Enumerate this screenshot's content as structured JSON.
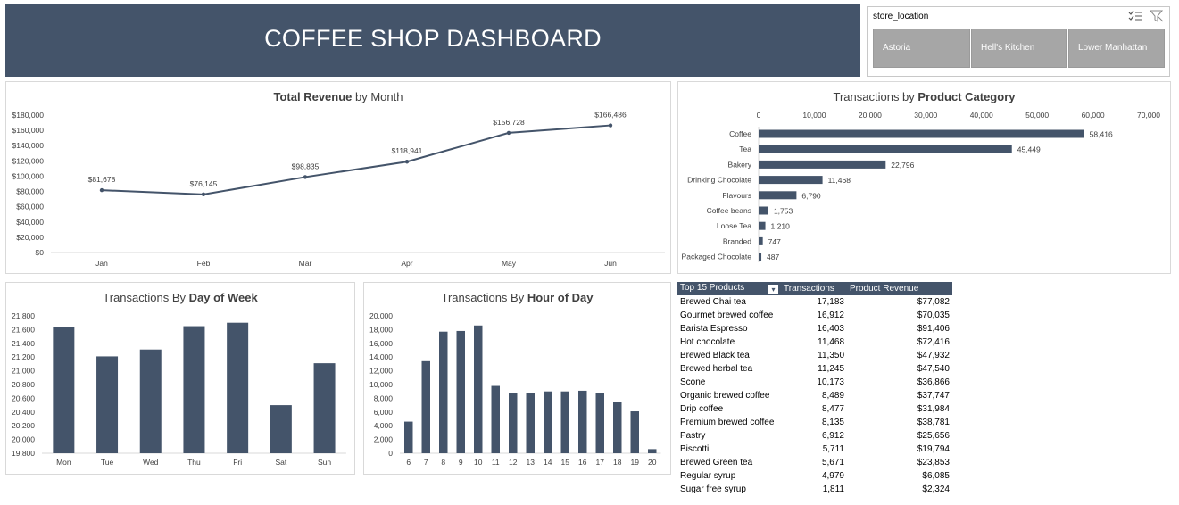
{
  "header": {
    "title": "COFFEE SHOP DASHBOARD"
  },
  "slicer": {
    "title": "store_location",
    "options": [
      "Astoria",
      "Hell's Kitchen",
      "Lower Manhattan"
    ]
  },
  "colors": {
    "banner": "#44546a",
    "series": "#44546a",
    "slicer_button": "#a6a6a6"
  },
  "icons": {
    "multi_select": "multi-select-icon",
    "clear_filter": "clear-filter-icon"
  },
  "chart_data": [
    {
      "id": "revenue",
      "type": "line",
      "title_bold": "Total Revenue",
      "title_rest": " by Month",
      "categories": [
        "Jan",
        "Feb",
        "Mar",
        "Apr",
        "May",
        "Jun"
      ],
      "values": [
        81678,
        76145,
        98835,
        118941,
        156728,
        166486
      ],
      "data_labels": [
        "$81,678",
        "$76,145",
        "$98,835",
        "$118,941",
        "$156,728",
        "$166,486"
      ],
      "y_ticks": [
        "$0",
        "$20,000",
        "$40,000",
        "$60,000",
        "$80,000",
        "$100,000",
        "$120,000",
        "$140,000",
        "$160,000",
        "$180,000"
      ],
      "ylim": [
        0,
        180000
      ],
      "grid": false
    },
    {
      "id": "category",
      "type": "bar",
      "orientation": "horizontal",
      "title_rest": "Transactions by ",
      "title_bold": "Product Category",
      "categories": [
        "Coffee",
        "Tea",
        "Bakery",
        "Drinking Chocolate",
        "Flavours",
        "Coffee beans",
        "Loose Tea",
        "Branded",
        "Packaged Chocolate"
      ],
      "values": [
        58416,
        45449,
        22796,
        11468,
        6790,
        1753,
        1210,
        747,
        487
      ],
      "data_labels": [
        "58,416",
        "45,449",
        "22,796",
        "11,468",
        "6,790",
        "1,753",
        "1,210",
        "747",
        "487"
      ],
      "x_ticks": [
        "0",
        "10,000",
        "20,000",
        "30,000",
        "40,000",
        "50,000",
        "60,000",
        "70,000"
      ],
      "xlim": [
        0,
        70000
      ],
      "axis_position": "top"
    },
    {
      "id": "weekday",
      "type": "bar",
      "title_rest": "Transactions By ",
      "title_bold": "Day of  Week",
      "categories": [
        "Mon",
        "Tue",
        "Wed",
        "Thu",
        "Fri",
        "Sat",
        "Sun"
      ],
      "values": [
        21640,
        21210,
        21310,
        21650,
        21700,
        20500,
        21110
      ],
      "y_ticks": [
        "19,800",
        "20,000",
        "20,200",
        "20,400",
        "20,600",
        "20,800",
        "21,000",
        "21,200",
        "21,400",
        "21,600",
        "21,800"
      ],
      "ylim": [
        19800,
        21800
      ]
    },
    {
      "id": "hour",
      "type": "bar",
      "title_rest": "Transactions By ",
      "title_bold": "Hour of Day",
      "categories": [
        "6",
        "7",
        "8",
        "9",
        "10",
        "11",
        "12",
        "13",
        "14",
        "15",
        "16",
        "17",
        "18",
        "19",
        "20"
      ],
      "values": [
        4600,
        13400,
        17700,
        17800,
        18600,
        9800,
        8700,
        8800,
        9000,
        9000,
        9100,
        8700,
        7500,
        6100,
        600
      ],
      "y_ticks": [
        "0",
        "2,000",
        "4,000",
        "6,000",
        "8,000",
        "10,000",
        "12,000",
        "14,000",
        "16,000",
        "18,000",
        "20,000"
      ],
      "ylim": [
        0,
        20000
      ]
    }
  ],
  "top15": {
    "headers": [
      "Top 15 Products",
      "Transactions",
      "Product Revenue"
    ],
    "rows": [
      [
        "Brewed Chai tea",
        "17,183",
        "$77,082"
      ],
      [
        "Gourmet brewed coffee",
        "16,912",
        "$70,035"
      ],
      [
        "Barista Espresso",
        "16,403",
        "$91,406"
      ],
      [
        "Hot chocolate",
        "11,468",
        "$72,416"
      ],
      [
        "Brewed Black tea",
        "11,350",
        "$47,932"
      ],
      [
        "Brewed herbal tea",
        "11,245",
        "$47,540"
      ],
      [
        "Scone",
        "10,173",
        "$36,866"
      ],
      [
        "Organic brewed coffee",
        "8,489",
        "$37,747"
      ],
      [
        "Drip coffee",
        "8,477",
        "$31,984"
      ],
      [
        "Premium brewed coffee",
        "8,135",
        "$38,781"
      ],
      [
        "Pastry",
        "6,912",
        "$25,656"
      ],
      [
        "Biscotti",
        "5,711",
        "$19,794"
      ],
      [
        "Brewed Green tea",
        "5,671",
        "$23,853"
      ],
      [
        "Regular syrup",
        "4,979",
        "$6,085"
      ],
      [
        "Sugar free syrup",
        "1,811",
        "$2,324"
      ]
    ]
  }
}
